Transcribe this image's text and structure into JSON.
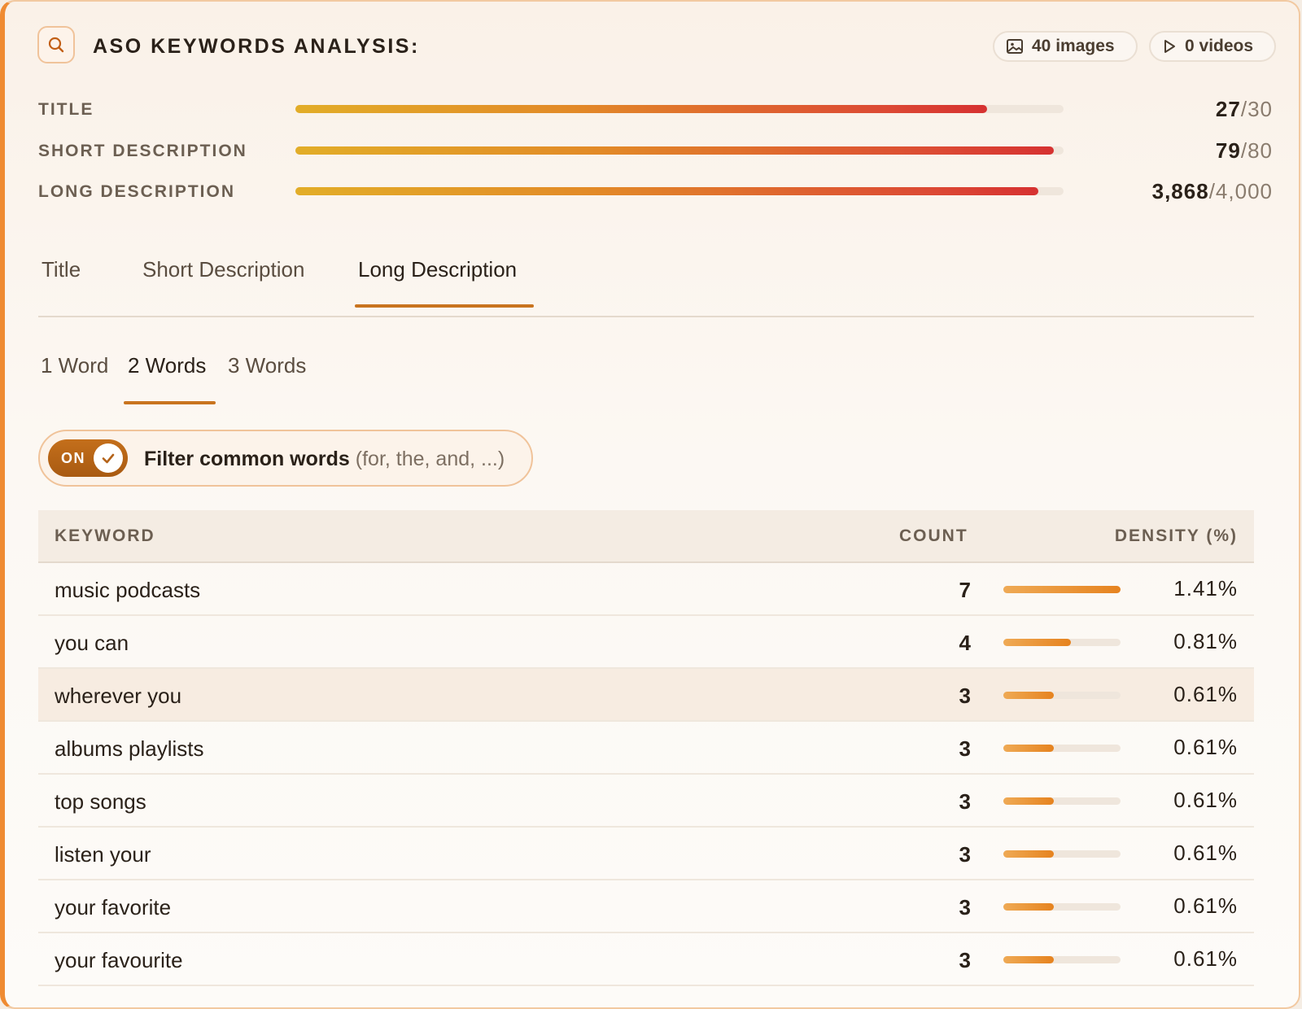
{
  "header": {
    "title": "ASO KEYWORDS ANALYSIS:",
    "search_icon": "search-icon",
    "images_label": "40 images",
    "videos_label": "0 videos",
    "accent_color": "#ef8b32"
  },
  "meters": [
    {
      "label": "TITLE",
      "value": "27",
      "max": "/30",
      "fraction": 0.9
    },
    {
      "label": "SHORT DESCRIPTION",
      "value": "79",
      "max": "/80",
      "fraction": 0.9875
    },
    {
      "label": "LONG DESCRIPTION",
      "value": "3,868",
      "max": "/4,000",
      "fraction": 0.967
    }
  ],
  "tabs": [
    "Title",
    "Short Description",
    "Long Description"
  ],
  "active_tab": "Long Description",
  "subtabs": [
    "1 Word",
    "2 Words",
    "3 Words"
  ],
  "active_subtab": "2 Words",
  "filter": {
    "toggle_label": "ON",
    "label": "Filter common words",
    "hint": "(for, the, and, ...)"
  },
  "table": {
    "headers": {
      "keyword": "KEYWORD",
      "count": "COUNT",
      "density": "DENSITY (%)"
    },
    "rows": [
      {
        "keyword": "music podcasts",
        "count": "7",
        "density": "1.41%",
        "bar": 1.0
      },
      {
        "keyword": "you can",
        "count": "4",
        "density": "0.81%",
        "bar": 0.574
      },
      {
        "keyword": "wherever you",
        "count": "3",
        "density": "0.61%",
        "bar": 0.433
      },
      {
        "keyword": "albums playlists",
        "count": "3",
        "density": "0.61%",
        "bar": 0.433
      },
      {
        "keyword": "top songs",
        "count": "3",
        "density": "0.61%",
        "bar": 0.433
      },
      {
        "keyword": "listen your",
        "count": "3",
        "density": "0.61%",
        "bar": 0.433
      },
      {
        "keyword": "your favorite",
        "count": "3",
        "density": "0.61%",
        "bar": 0.433
      },
      {
        "keyword": "your favourite",
        "count": "3",
        "density": "0.61%",
        "bar": 0.433
      }
    ]
  }
}
